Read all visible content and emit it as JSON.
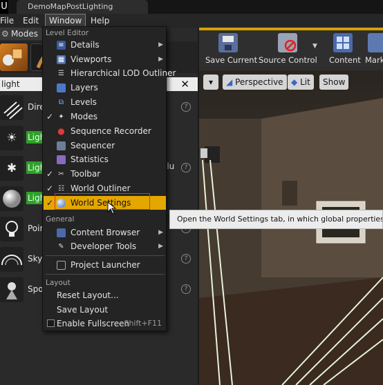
{
  "app": {
    "tab_title": "DemoMapPostLighting",
    "logo_glyph": "U"
  },
  "menubar": {
    "file": "File",
    "edit": "Edit",
    "window": "Window",
    "help": "Help"
  },
  "modes_panel": {
    "tab_label": "Modes",
    "search_value": "light",
    "partial_label": "olu",
    "actors": [
      {
        "label": "Dire",
        "highlighted": false,
        "icon": "directional-light-icon"
      },
      {
        "label": "Light",
        "highlighted": true,
        "icon": "sun-light-icon"
      },
      {
        "label": "Light",
        "highlighted": true,
        "icon": "spark-light-icon"
      },
      {
        "label": "Light",
        "highlighted": true,
        "icon": "sphere-light-icon"
      },
      {
        "label": "Point",
        "highlighted": false,
        "icon": "bulb-icon"
      },
      {
        "label": "Sky",
        "highlighted": false,
        "icon": "sky-light-icon"
      },
      {
        "label": "Spot",
        "highlighted": false,
        "icon": "spot-light-icon"
      }
    ]
  },
  "toolbar": {
    "save_current": "Save Current",
    "source_control": "Source Control",
    "content": "Content",
    "marketplace": "Mark"
  },
  "viewport": {
    "perspective": "Perspective",
    "lit": "Lit",
    "show": "Show"
  },
  "window_menu": {
    "sections": {
      "level_editor": "Level Editor",
      "general": "General",
      "layout": "Layout"
    },
    "items": [
      {
        "label": "Details",
        "checked": false,
        "submenu": true,
        "icon": "details-icon"
      },
      {
        "label": "Viewports",
        "checked": false,
        "submenu": true,
        "icon": "viewports-icon"
      },
      {
        "label": "Hierarchical LOD Outliner",
        "checked": false,
        "submenu": false,
        "icon": "hlod-icon"
      },
      {
        "label": "Layers",
        "checked": false,
        "submenu": false,
        "icon": "layers-icon"
      },
      {
        "label": "Levels",
        "checked": false,
        "submenu": false,
        "icon": "levels-icon"
      },
      {
        "label": "Modes",
        "checked": true,
        "submenu": false,
        "icon": "modes-icon"
      },
      {
        "label": "Sequence Recorder",
        "checked": false,
        "submenu": false,
        "icon": "record-icon"
      },
      {
        "label": "Sequencer",
        "checked": false,
        "submenu": false,
        "icon": "sequencer-icon"
      },
      {
        "label": "Statistics",
        "checked": false,
        "submenu": false,
        "icon": "statistics-icon"
      },
      {
        "label": "Toolbar",
        "checked": true,
        "submenu": false,
        "icon": "toolbar-icon"
      },
      {
        "label": "World Outliner",
        "checked": true,
        "submenu": false,
        "icon": "outliner-icon"
      },
      {
        "label": "World Settings",
        "checked": true,
        "submenu": false,
        "icon": "world-icon",
        "selected": true
      }
    ],
    "general_items": [
      {
        "label": "Content Browser",
        "submenu": true,
        "icon": "content-browser-icon"
      },
      {
        "label": "Developer Tools",
        "submenu": true,
        "icon": "developer-tools-icon"
      },
      {
        "label": "Project Launcher",
        "submenu": false,
        "icon": "launcher-icon"
      }
    ],
    "layout_items": [
      {
        "label": "Reset Layout..."
      },
      {
        "label": "Save Layout"
      },
      {
        "label": "Enable Fullscreen",
        "shortcut": "Shift+F11",
        "checkbox": true
      }
    ]
  },
  "tooltip": {
    "text": "Open the World Settings tab, in which global properties of the le"
  },
  "colors": {
    "selected": "#e3a700",
    "highlight_green": "#2fa02a",
    "toolbar_accent": "#d8a100",
    "annotation_red": "#e03030"
  }
}
